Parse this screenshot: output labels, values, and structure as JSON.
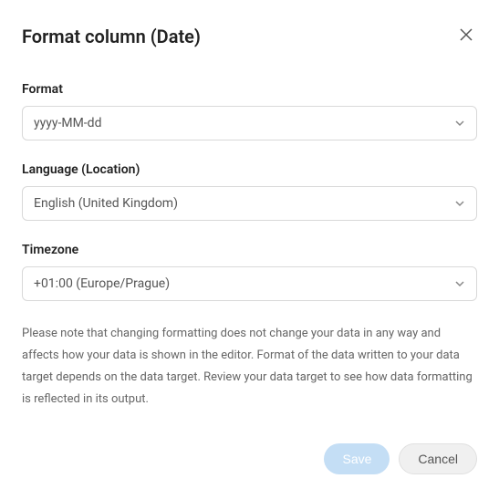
{
  "dialog": {
    "title": "Format column (Date)"
  },
  "fields": {
    "format": {
      "label": "Format",
      "value": "yyyy-MM-dd"
    },
    "language": {
      "label": "Language (Location)",
      "value": "English (United Kingdom)"
    },
    "timezone": {
      "label": "Timezone",
      "value": "+01:00 (Europe/Prague)"
    }
  },
  "note": "Please note that changing formatting does not change your data in any way and affects how your data is shown in the editor. Format of the data written to your data target depends on the data target. Review your data target to see how data formatting is reflected in its output.",
  "buttons": {
    "save": "Save",
    "cancel": "Cancel"
  }
}
